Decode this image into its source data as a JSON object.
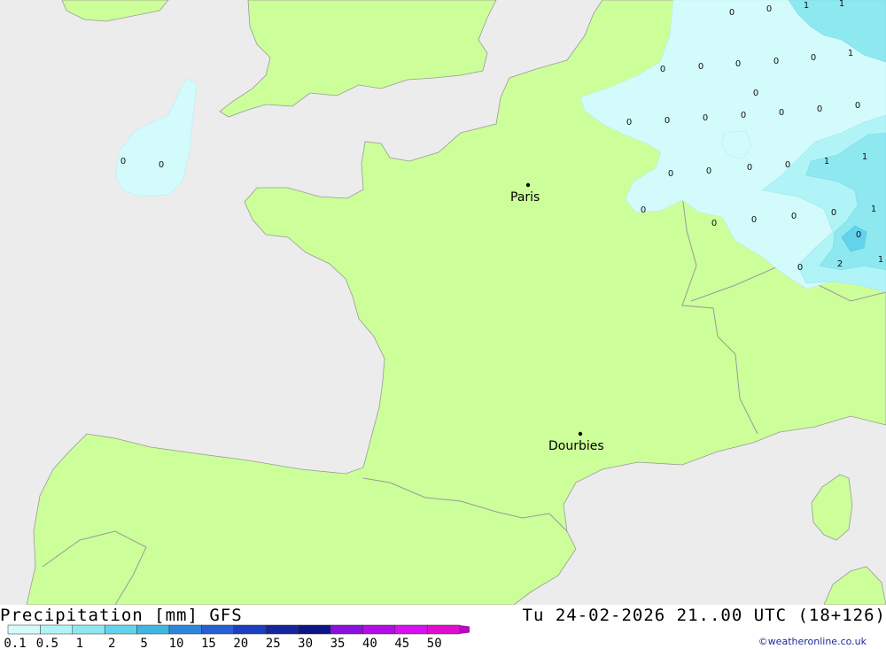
{
  "map": {
    "cities": [
      {
        "name": "Paris"
      },
      {
        "name": "Dourbies"
      }
    ],
    "precip_labels": [
      "0",
      "0",
      "1",
      "1",
      "0",
      "0",
      "0",
      "0",
      "1",
      "0",
      "0",
      "0",
      "0",
      "0",
      "0",
      "0",
      "0",
      "0",
      "0",
      "0",
      "0",
      "0",
      "0",
      "0",
      "1",
      "1",
      "0",
      "0",
      "0",
      "0",
      "1",
      "0",
      "2",
      "1",
      "0",
      "0"
    ]
  },
  "footer": {
    "title": "Precipitation [mm] GFS",
    "valid_time": "Tu 24-02-2026 21..00 UTC (18+126)",
    "credit": "©weatheronline.co.uk"
  },
  "legend": {
    "ticks": [
      "0.1",
      "0.5",
      "1",
      "2",
      "5",
      "10",
      "15",
      "20",
      "25",
      "30",
      "35",
      "40",
      "45",
      "50"
    ],
    "colors": [
      "#d3fbfb",
      "#b0f4f7",
      "#8de8f0",
      "#62d3ea",
      "#3fb6e4",
      "#2e86dc",
      "#2560d4",
      "#1c3fc2",
      "#15259f",
      "#0d1488",
      "#8b0fe0",
      "#b30ce8",
      "#d910f0",
      "#e20cd0",
      "#b010b8"
    ]
  },
  "colors": {
    "land": "#ccff99",
    "sea": "#ececec",
    "border": "#9a9a9a"
  }
}
